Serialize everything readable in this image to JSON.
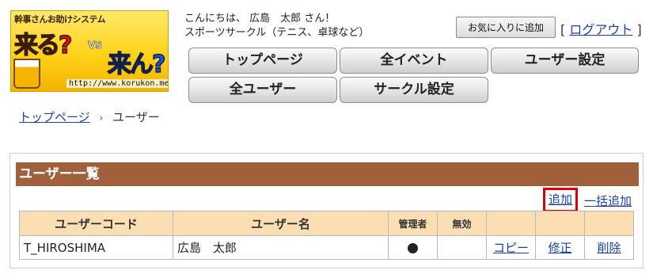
{
  "logo": {
    "tagline": "幹事さんお助けシステム",
    "word1": "来る?",
    "vs": "VS",
    "word2": "来ん?",
    "url": "http://www.korukon.me"
  },
  "greeting": {
    "line1": "こんにちは、 広島　太郎 さん！",
    "line2": "スポーツサークル（テニス、卓球など）"
  },
  "header": {
    "favorite_label": "お気に入りに追加",
    "bracket_open": "[",
    "logout_label": "ログアウト",
    "bracket_close": "]"
  },
  "nav": {
    "top": "トップページ",
    "events": "全イベント",
    "user_settings": "ユーザー設定",
    "users": "全ユーザー",
    "circle_settings": "サークル設定"
  },
  "breadcrumb": {
    "home": "トップページ",
    "sep": "›",
    "current": "ユーザー"
  },
  "panel": {
    "title": "ユーザー一覧",
    "add_label": "追加",
    "bulk_add_label": "一括追加"
  },
  "table": {
    "headers": {
      "code": "ユーザーコード",
      "name": "ユーザー名",
      "admin": "管理者",
      "disabled": "無効"
    },
    "rows": [
      {
        "code": "T_HIROSHIMA",
        "name": "広島　太郎",
        "admin": true,
        "disabled": false,
        "copy": "コピー",
        "edit": "修正",
        "delete": "削除"
      }
    ]
  },
  "colors": {
    "panel_header": "#a0603c",
    "table_header": "#fbdfb2",
    "link": "#1a3fb0",
    "highlight": "#e00000"
  }
}
